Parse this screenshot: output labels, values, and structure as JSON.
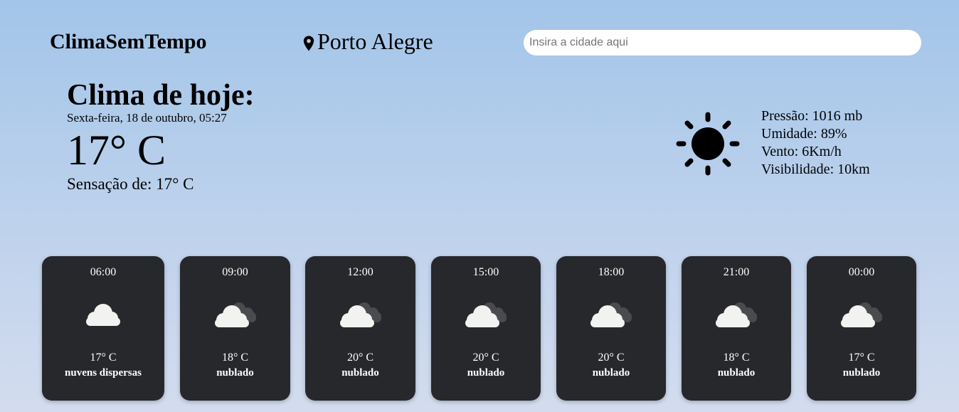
{
  "header": {
    "brand": "ClimaSemTempo",
    "location": "Porto Alegre",
    "search_placeholder": "Insira a cidade aqui"
  },
  "today": {
    "title": "Clima de hoje:",
    "date": "Sexta-feira, 18 de outubro, 05:27",
    "temp": "17° C",
    "feels_like": "Sensação de: 17° C",
    "icon": "sun-icon",
    "details": {
      "pressure": "Pressão: 1016 mb",
      "humidity": "Umidade: 89%",
      "wind": "Vento: 6Km/h",
      "visibility": "Visibilidade: 10km"
    }
  },
  "forecast": [
    {
      "time": "06:00",
      "temp": "17° C",
      "desc": "nuvens dispersas",
      "icon": "scattered-clouds-icon"
    },
    {
      "time": "09:00",
      "temp": "18° C",
      "desc": "nublado",
      "icon": "overcast-clouds-icon"
    },
    {
      "time": "12:00",
      "temp": "20° C",
      "desc": "nublado",
      "icon": "overcast-clouds-icon"
    },
    {
      "time": "15:00",
      "temp": "20° C",
      "desc": "nublado",
      "icon": "overcast-clouds-icon"
    },
    {
      "time": "18:00",
      "temp": "20° C",
      "desc": "nublado",
      "icon": "overcast-clouds-icon"
    },
    {
      "time": "21:00",
      "temp": "18° C",
      "desc": "nublado",
      "icon": "overcast-clouds-icon"
    },
    {
      "time": "00:00",
      "temp": "17° C",
      "desc": "nublado",
      "icon": "overcast-clouds-icon"
    }
  ],
  "colors": {
    "card_bg": "#27282c",
    "cloud_front": "#f2f2f0",
    "cloud_back": "#4a4b4f"
  }
}
